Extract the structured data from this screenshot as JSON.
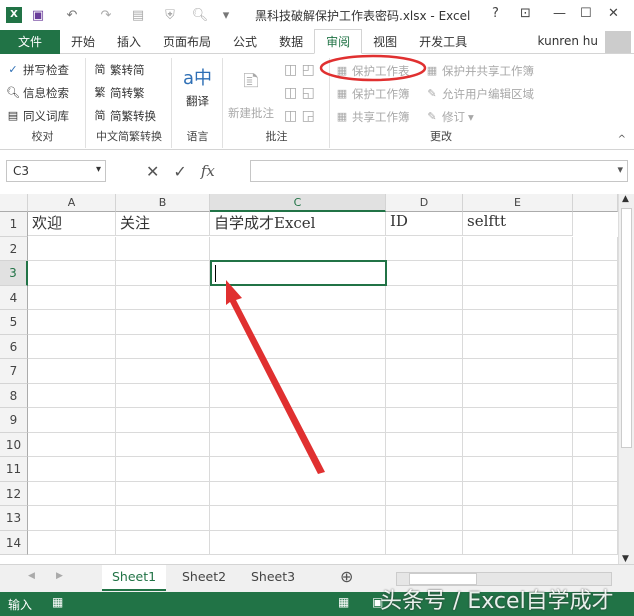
{
  "title": "黑科技破解保护工作表密码.xlsx - Excel",
  "window_controls": [
    "?",
    "⊡",
    "—",
    "☐",
    "✕"
  ],
  "tabs": [
    "文件",
    "开始",
    "插入",
    "页面布局",
    "公式",
    "数据",
    "审阅",
    "视图",
    "开发工具"
  ],
  "active_tab": "审阅",
  "user": "kunren hu",
  "ribbon": {
    "proofing": {
      "label": "校对",
      "items": [
        "拼写检查",
        "信息检索",
        "同义词库"
      ]
    },
    "chinese": {
      "label": "中文简繁转换",
      "items": [
        "繁转简",
        "简转繁",
        "简繁转换"
      ]
    },
    "language": {
      "label": "语言",
      "items": [
        "翻译"
      ]
    },
    "comments": {
      "label": "批注",
      "items": [
        "新建批注"
      ]
    },
    "changes": {
      "label": "更改",
      "items": [
        "保护工作表",
        "保护工作簿",
        "共享工作簿",
        "保护并共享工作簿",
        "允许用户编辑区域",
        "修订"
      ]
    }
  },
  "name_box": "C3",
  "fx_label": "fx",
  "columns": [
    "A",
    "B",
    "C",
    "D",
    "E"
  ],
  "selected_column": "C",
  "rows": [
    "1",
    "2",
    "3",
    "4",
    "5",
    "6",
    "7",
    "8",
    "9",
    "10",
    "11",
    "12",
    "13",
    "14"
  ],
  "selected_row": "3",
  "row1": [
    "欢迎",
    "关注",
    "自学成才Excel",
    "ID",
    "selftt"
  ],
  "sheets": [
    "Sheet1",
    "Sheet2",
    "Sheet3"
  ],
  "active_sheet": "Sheet1",
  "status": {
    "mode": "输入"
  },
  "watermark": "头条号 / Excel自学成才",
  "colors": {
    "accent": "#217346",
    "annotation": "#e03030"
  }
}
